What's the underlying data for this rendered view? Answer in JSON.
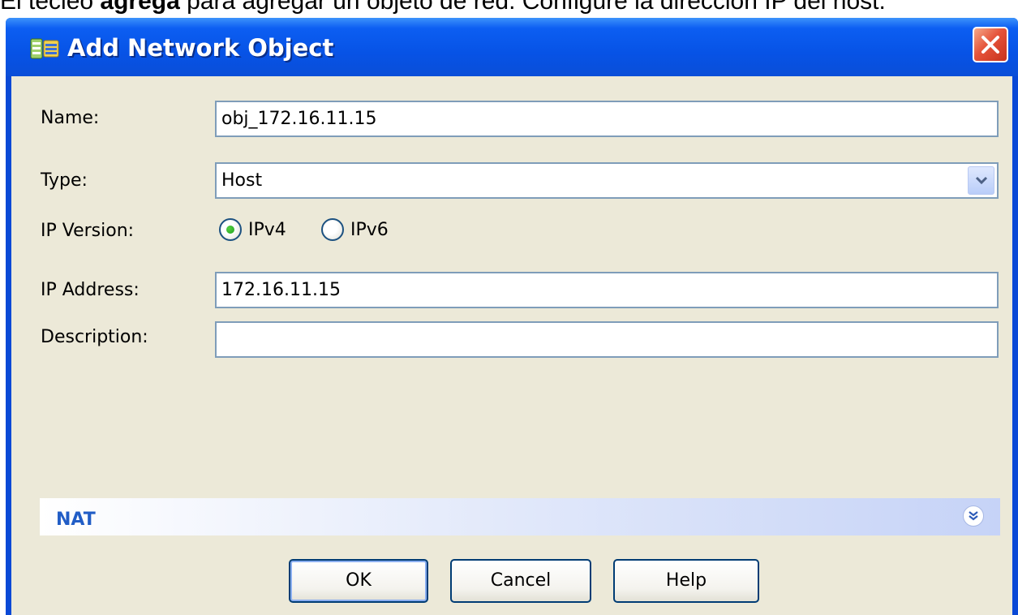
{
  "caption": {
    "before": "El tecleo ",
    "bold": "agrega",
    "after": " para agregar un objeto de red. Configure la dirección IP del host."
  },
  "window": {
    "title": "Add Network Object",
    "title_icon": "network-object-icon",
    "close_icon": "close-icon"
  },
  "form": {
    "name_label": "Name:",
    "name_value": "obj_172.16.11.15",
    "type_label": "Type:",
    "type_value": "Host",
    "ip_version_label": "IP Version:",
    "ipv4_label": "IPv4",
    "ipv6_label": "IPv6",
    "ipv4_selected": true,
    "ip_address_label": "IP Address:",
    "ip_address_value": "172.16.11.15",
    "description_label": "Description:",
    "description_value": ""
  },
  "nat": {
    "label": "NAT",
    "expand_icon": "double-chevron-down-icon"
  },
  "buttons": {
    "ok": "OK",
    "cancel": "Cancel",
    "help": "Help"
  },
  "colors": {
    "title_bar": "#0753e6",
    "dialog_bg": "#ece9d8",
    "input_border": "#7f9db9",
    "nat_text": "#215dc6",
    "close_button": "#e5533a"
  }
}
